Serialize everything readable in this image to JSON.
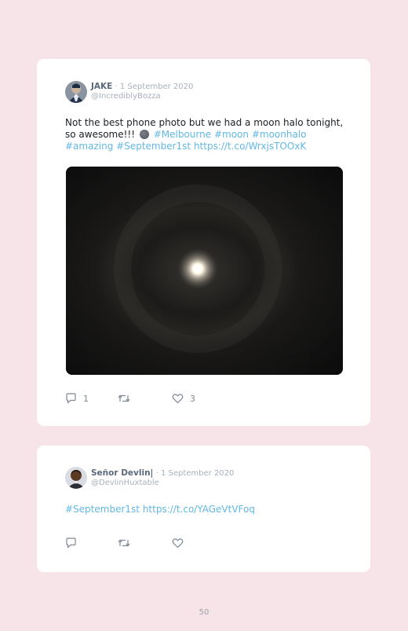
{
  "tweets": [
    {
      "name": "JAKE",
      "separator": " · ",
      "date": "1 September 2020",
      "handle": "@IncrediblyBozza",
      "text_before_emoji": "Not the best phone photo but we had a moon halo tonight, so awesome!!!",
      "emoji": "moon-emoji",
      "links": [
        "#Melbourne",
        "#moon",
        "#moonhalo",
        "#amazing",
        "#September1st",
        "https://t.co/WrxjsTOOxK"
      ],
      "reply_count": "1",
      "retweet_count": "",
      "like_count": "3",
      "icons": [
        "reply-icon",
        "retweet-icon",
        "heart-icon"
      ]
    },
    {
      "name": "Señor Devlin|",
      "separator": " · ",
      "date": "1 September 2020",
      "handle": "@DevlinHuxtable",
      "links": [
        "#September1st",
        "https://t.co/YAGeVtVFoq"
      ],
      "reply_count": "",
      "retweet_count": "",
      "like_count": "",
      "icons": [
        "reply-icon",
        "retweet-icon",
        "heart-icon"
      ]
    }
  ],
  "page_number": "50",
  "colors": {
    "background": "#f7e4e8",
    "card": "#ffffff",
    "link": "#61b8e6",
    "name": "#5a6a7c",
    "muted": "#a7b1bc"
  }
}
